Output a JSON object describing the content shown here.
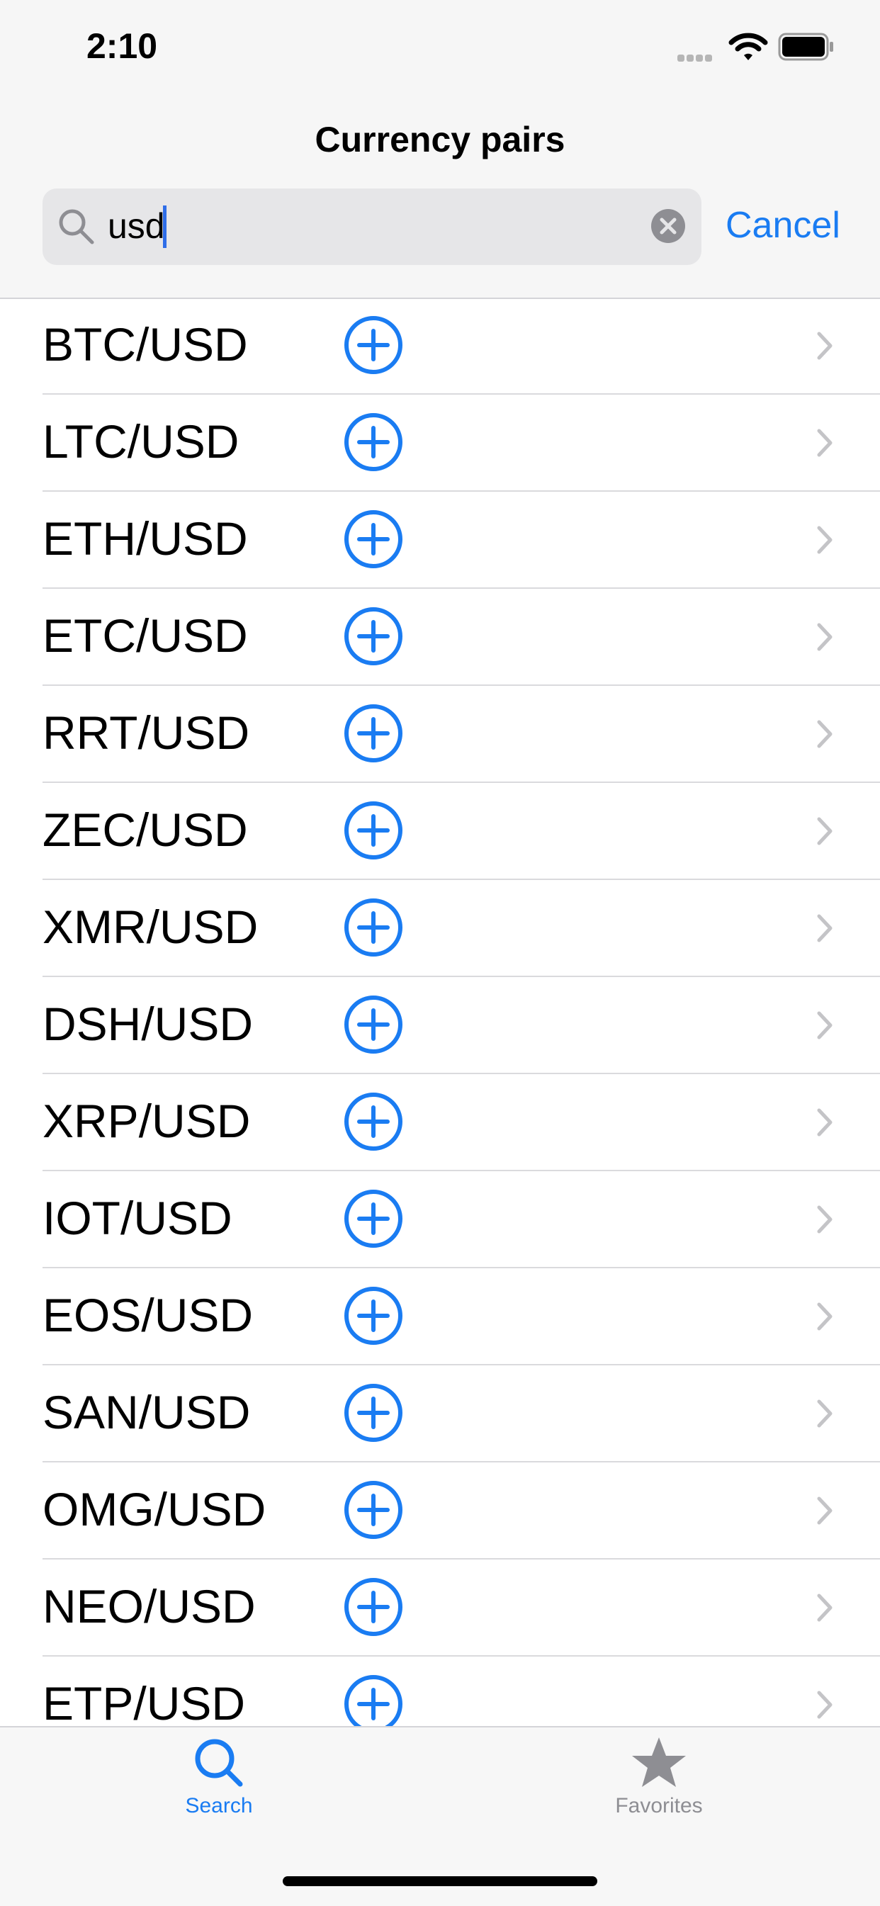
{
  "status_bar": {
    "time": "2:10"
  },
  "nav": {
    "title": "Currency pairs"
  },
  "search": {
    "value": "usd",
    "cancel_label": "Cancel"
  },
  "pairs": [
    "BTC/USD",
    "LTC/USD",
    "ETH/USD",
    "ETC/USD",
    "RRT/USD",
    "ZEC/USD",
    "XMR/USD",
    "DSH/USD",
    "XRP/USD",
    "IOT/USD",
    "EOS/USD",
    "SAN/USD",
    "OMG/USD",
    "NEO/USD",
    "ETP/USD"
  ],
  "tabs": [
    {
      "label": "Search",
      "icon": "search-icon",
      "selected": true
    },
    {
      "label": "Favorites",
      "icon": "star-icon",
      "selected": false
    }
  ],
  "colors": {
    "accent": "#1a7cf2",
    "inactive": "#8e8e93"
  }
}
